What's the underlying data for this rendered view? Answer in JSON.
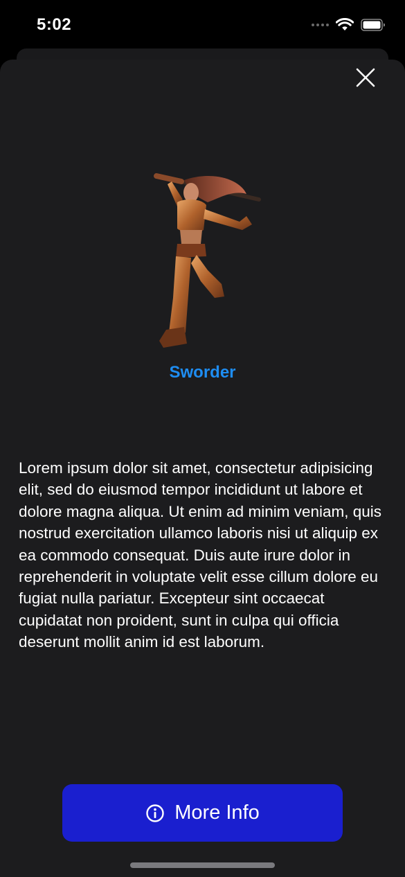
{
  "status_bar": {
    "time": "5:02",
    "icons": [
      "cellular-dots-icon",
      "wifi-icon",
      "battery-icon"
    ]
  },
  "sheet": {
    "close_icon": "close-icon",
    "character": {
      "name": "Sworder",
      "image": "warrior-woman-with-sword"
    },
    "description": "Lorem ipsum dolor sit amet, consectetur adipisicing elit, sed do eiusmod tempor incididunt ut labore et dolore magna aliqua. Ut enim ad minim veniam, quis nostrud exercitation ullamco laboris nisi ut aliquip ex ea commodo consequat. Duis aute irure dolor in reprehenderit in voluptate velit esse cillum dolore eu fugiat nulla pariatur. Excepteur sint occaecat cupidatat non proident, sunt in culpa qui officia deserunt mollit anim id est laborum.",
    "button": {
      "label": "More Info",
      "icon": "info-circle-icon"
    }
  },
  "colors": {
    "background": "#000000",
    "sheet": "#1c1c1e",
    "accent_text": "#1e8df2",
    "button": "#1a1fcf",
    "text": "#ffffff"
  }
}
